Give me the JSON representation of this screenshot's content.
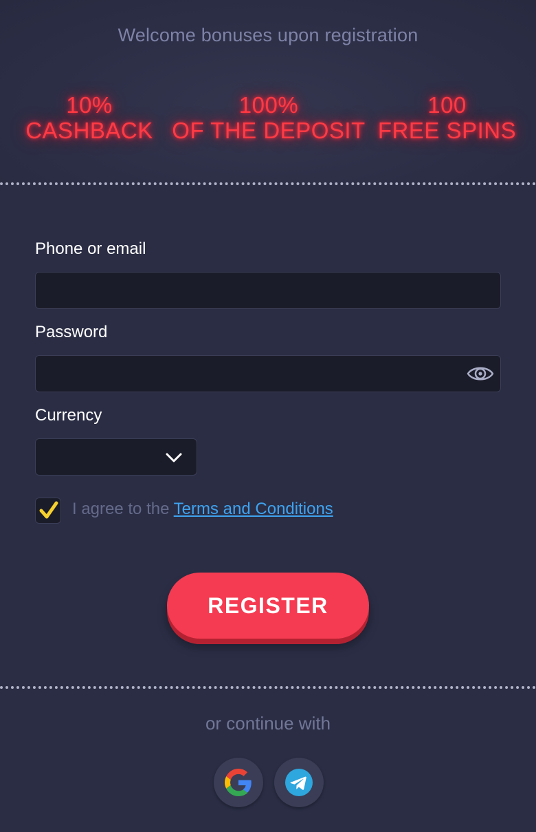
{
  "header": {
    "welcome": "Welcome bonuses upon registration",
    "bonuses": [
      {
        "top": "10%",
        "bottom": "CASHBACK"
      },
      {
        "top": "100%",
        "bottom": "OF THE DEPOSIT"
      },
      {
        "top": "100",
        "bottom": "FREE SPINS"
      }
    ]
  },
  "form": {
    "phone_label": "Phone or email",
    "phone_value": "",
    "password_label": "Password",
    "password_value": "",
    "currency_label": "Currency",
    "currency_value": "",
    "agree_prefix": "I agree to the ",
    "terms_link": "Terms and Conditions",
    "agree_checked": true,
    "register_label": "REGISTER"
  },
  "social": {
    "continue_text": "or continue with",
    "providers": [
      "google-icon",
      "telegram-icon"
    ]
  },
  "colors": {
    "background": "#2a2d44",
    "accent": "#f53b51",
    "neon": "#ff3b45",
    "link": "#3fa3f0",
    "check": "#f5d02e"
  }
}
